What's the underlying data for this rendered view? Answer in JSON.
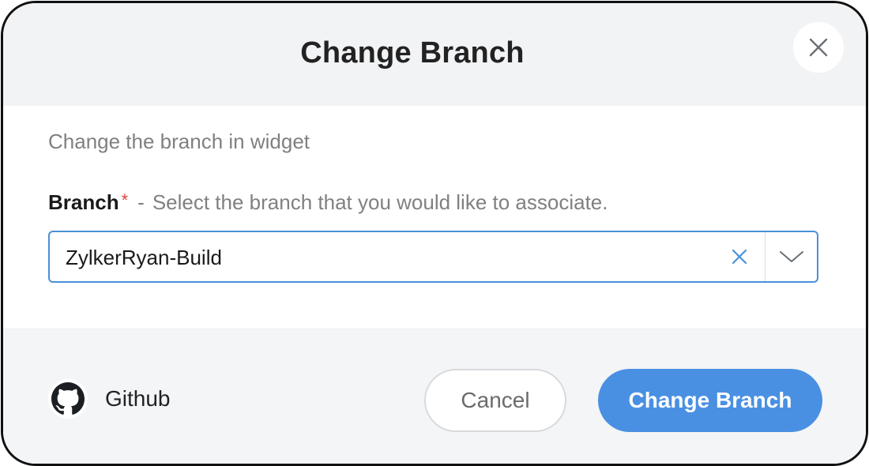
{
  "dialog": {
    "title": "Change Branch",
    "description": "Change the branch in widget",
    "close_icon": "close-icon"
  },
  "field": {
    "label": "Branch",
    "required_marker": "*",
    "separator": "-",
    "hint": "Select the branch that you would like to associate.",
    "value": "ZylkerRyan-Build",
    "clear_icon": "clear-icon",
    "dropdown_icon": "chevron-down-icon"
  },
  "footer": {
    "provider_icon": "github-icon",
    "provider_label": "Github",
    "cancel_label": "Cancel",
    "submit_label": "Change Branch"
  },
  "colors": {
    "accent": "#4a90e2",
    "required": "#e0453a",
    "header_bg": "#f2f3f5",
    "footer_bg": "#f4f5f7"
  }
}
